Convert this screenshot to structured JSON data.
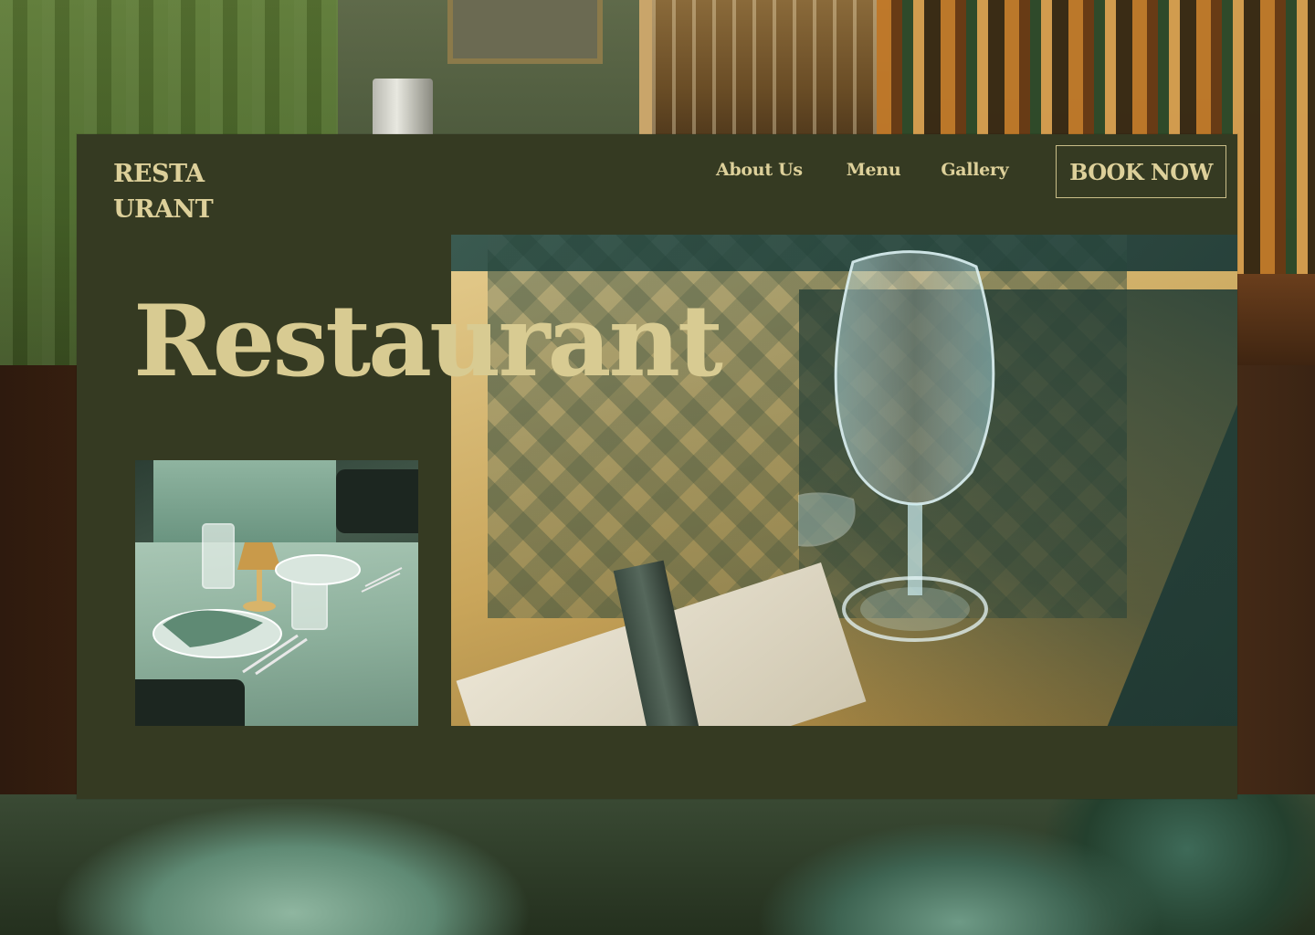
{
  "brand": {
    "logo_line_1": "RESTA",
    "logo_line_2": "URANT"
  },
  "nav": {
    "items": [
      {
        "label": "About Us"
      },
      {
        "label": "Menu"
      },
      {
        "label": "Gallery"
      }
    ],
    "cta_label": "BOOK NOW"
  },
  "hero": {
    "title": "Restaurant"
  },
  "theme": {
    "card_background": "#353a22",
    "accent_text": "#ddd09a",
    "headline_color": "#d8cb92"
  },
  "images": {
    "hero": "wine-glass-on-table-photo",
    "secondary": "set-dining-table-photo",
    "background": "restaurant-interior-photo"
  }
}
